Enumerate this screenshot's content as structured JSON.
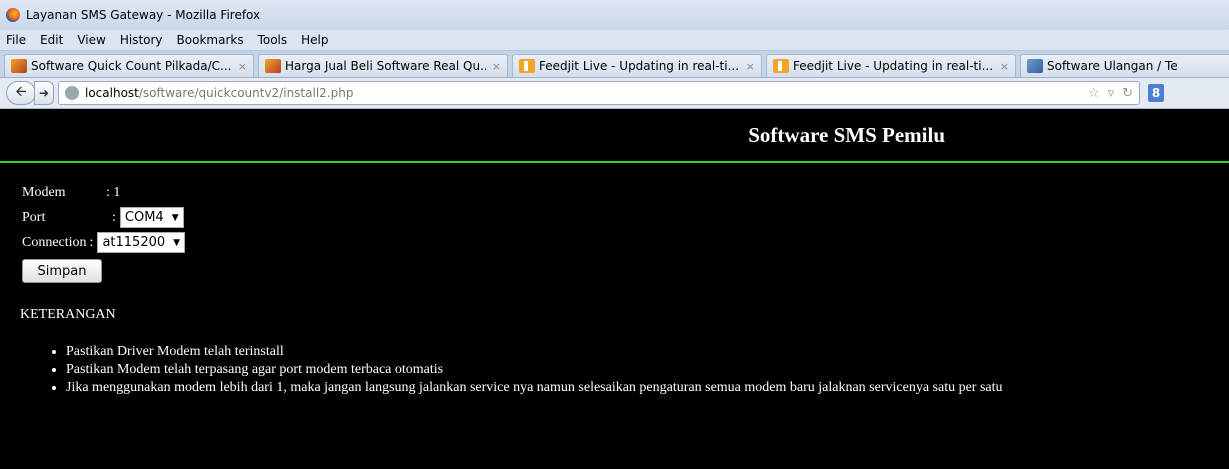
{
  "window": {
    "title": "Layanan SMS Gateway - Mozilla Firefox"
  },
  "menu": [
    "File",
    "Edit",
    "View",
    "History",
    "Bookmarks",
    "Tools",
    "Help"
  ],
  "tabs": [
    {
      "label": "Software Quick Count Pilkada/C...",
      "icon": "catcat-icon",
      "close": "×"
    },
    {
      "label": "Harga Jual Beli Software Real Qu...",
      "icon": "catcat-icon",
      "close": "×"
    },
    {
      "label": "Feedjit Live - Updating in real-ti...",
      "icon": "feedjit-icon",
      "close": "×"
    },
    {
      "label": "Feedjit Live - Updating in real-ti...",
      "icon": "feedjit-icon",
      "close": "×"
    },
    {
      "label": "Software Ulangan / Te",
      "icon": "site-icon",
      "close": ""
    }
  ],
  "url": {
    "host": "localhost",
    "path": "/software/quickcountv2/install2.php"
  },
  "page": {
    "title": "Software SMS Pemilu",
    "modem_label": "Modem",
    "modem_value": ": 1",
    "port_label": "Port",
    "port_sep": ":",
    "port_value": "COM4",
    "connection_label": "Connection",
    "connection_sep": ":",
    "connection_value": "at115200",
    "save_label": "Simpan",
    "keterangan": "KETERANGAN",
    "notes": [
      "Pastikan Driver Modem telah terinstall",
      "Pastikan Modem telah terpasang agar port modem terbaca otomatis",
      "Jika menggunakan modem lebih dari 1, maka jangan langsung jalankan service nya namun selesaikan pengaturan semua modem baru jalaknan servicenya satu per satu"
    ]
  },
  "colors": {
    "page_bg": "#000000",
    "rule": "#2bd22b",
    "text": "#ffffff"
  }
}
